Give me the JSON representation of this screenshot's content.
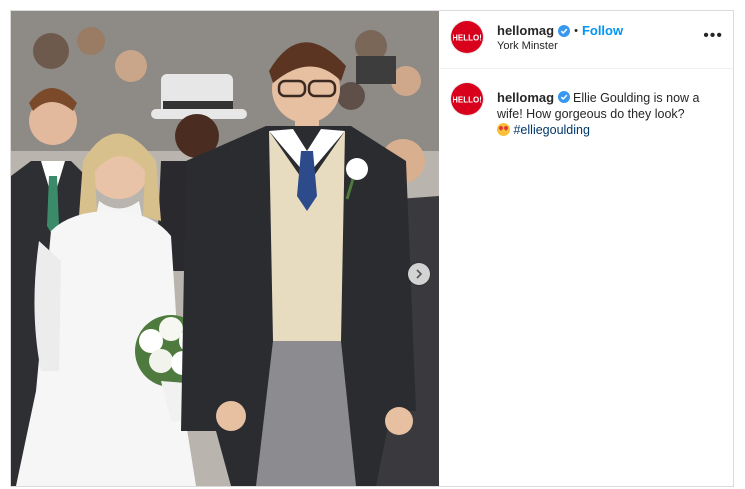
{
  "post": {
    "account": {
      "username": "hellomag",
      "avatar_text": "HELLO!",
      "verified_icon": "verified-badge-icon",
      "location": "York Minster",
      "follow_label": "Follow",
      "separator": "•",
      "more_label": "•••"
    },
    "caption": {
      "username": "hellomag",
      "text": "Ellie Goulding is now a wife! How gorgeous do they look?",
      "emoji_icon": "heart-eyes-emoji",
      "hashtag": "#elliegoulding"
    },
    "media": {
      "description_icon": "photo-wedding-couple",
      "next_icon": "chevron-right-icon"
    },
    "colors": {
      "brand_red": "#d9001b",
      "link_blue": "#0095f6",
      "hashtag_blue": "#00376b",
      "text": "#262626"
    }
  }
}
